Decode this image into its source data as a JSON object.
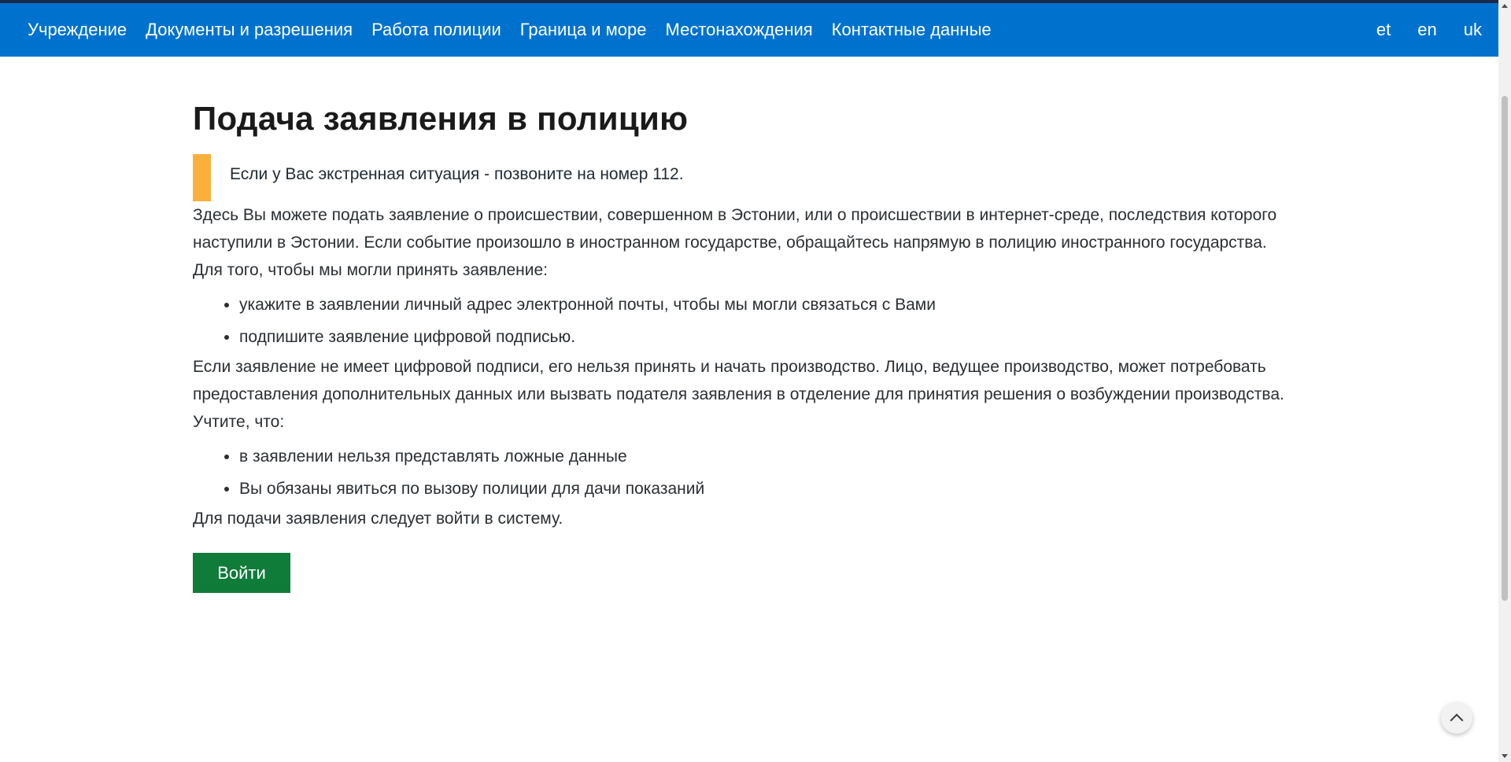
{
  "nav": {
    "items": [
      {
        "label": "Учреждение"
      },
      {
        "label": "Документы и разрешения"
      },
      {
        "label": "Работа полиции"
      },
      {
        "label": "Граница и море"
      },
      {
        "label": "Местонахождения"
      },
      {
        "label": "Контактные данные"
      }
    ],
    "languages": [
      "et",
      "en",
      "uk"
    ]
  },
  "main": {
    "title": "Подача заявления в полицию",
    "alert": "Если у Вас экстренная ситуация - позвоните на номер 112.",
    "intro": "Здесь Вы можете подать заявление о происшествии, совершенном в Эстонии, или о происшествии в интернет-среде, последствия которого наступили в Эстонии. Если событие произошло в иностранном государстве, обращайтесь напрямую в полицию иностранного государства.",
    "requirements_lead": "Для того, чтобы мы могли принять заявление:",
    "requirements": [
      "укажите в заявлении личный адрес электронной почты, чтобы мы могли связаться с Вами",
      "подпишите заявление цифровой подписью."
    ],
    "signature_note": "Если заявление не имеет цифровой подписи, его нельзя принять и начать производство. Лицо, ведущее производство, может потребовать предоставления дополнительных данных или вызвать подателя заявления в отделение для принятия решения о возбуждении производства.",
    "notes_lead": "Учтите, что:",
    "notes": [
      "в заявлении нельзя представлять ложные данные",
      "Вы обязаны явиться по вызову полиции для дачи показаний"
    ],
    "login_prompt": "Для подачи заявления следует войти в систему.",
    "login_button": "Войти"
  },
  "colors": {
    "nav_bg": "#0072ce",
    "alert_accent": "#fbb03b",
    "button_bg": "#0f7c3a"
  },
  "icons": {
    "scroll_top": "chevron-up-icon"
  }
}
